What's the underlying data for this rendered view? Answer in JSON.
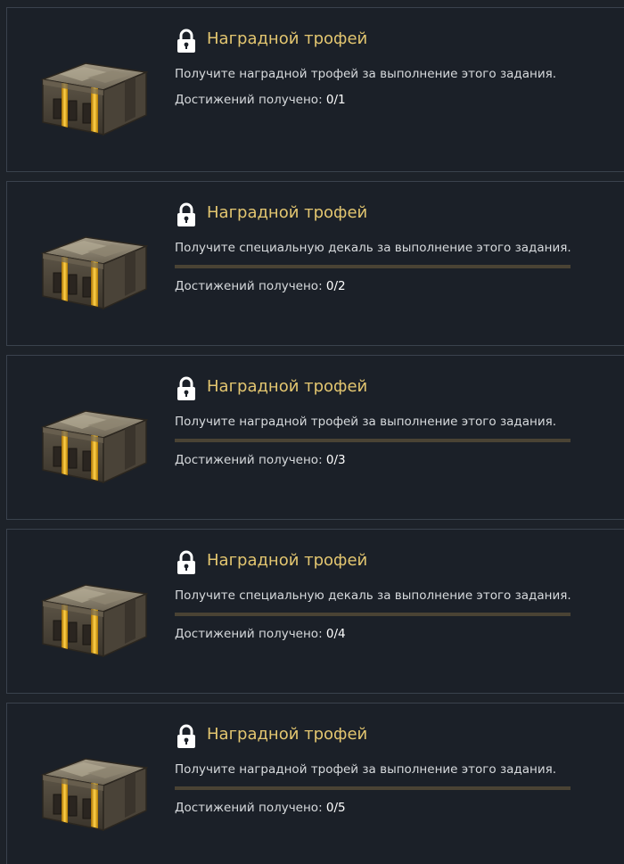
{
  "cards": [
    {
      "title": "Наградной трофей",
      "description": "Получите наградной трофей за выполнение этого задания.",
      "count_label": "Достижений получено:",
      "count_value": "0/1",
      "progress": 0,
      "show_bar": false
    },
    {
      "title": "Наградной трофей",
      "description": "Получите специальную декаль за выполнение этого задания.",
      "count_label": "Достижений получено:",
      "count_value": "0/2",
      "progress": 0,
      "show_bar": true
    },
    {
      "title": "Наградной трофей",
      "description": "Получите наградной трофей за выполнение этого задания.",
      "count_label": "Достижений получено:",
      "count_value": "0/3",
      "progress": 0,
      "show_bar": true
    },
    {
      "title": "Наградной трофей",
      "description": "Получите специальную декаль за выполнение этого задания.",
      "count_label": "Достижений получено:",
      "count_value": "0/4",
      "progress": 0,
      "show_bar": true
    },
    {
      "title": "Наградной трофей",
      "description": "Получите наградной трофей за выполнение этого задания.",
      "count_label": "Достижений получено:",
      "count_value": "0/5",
      "progress": 0,
      "show_bar": true
    }
  ],
  "icons": {
    "chest": "reward-chest-icon",
    "lock": "padlock-icon"
  },
  "colors": {
    "title": "#e3c670",
    "text": "#d7dadd",
    "card_bg": "#1b2028",
    "border": "#3a424d",
    "bar_track": "#4a4334",
    "chest_gold": "#f0b820"
  }
}
